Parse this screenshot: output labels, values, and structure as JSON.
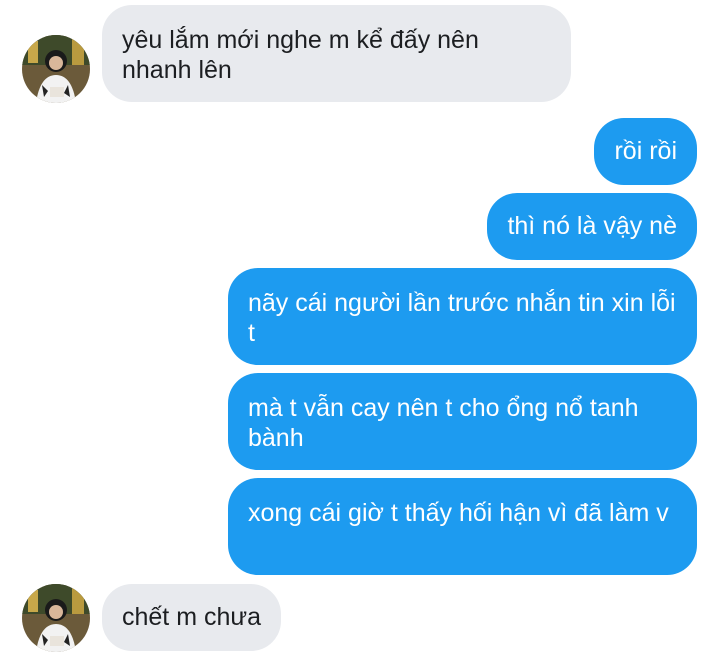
{
  "conversation": {
    "messages": [
      {
        "direction": "incoming",
        "text": "yêu lắm mới nghe m kể đấy nên nhanh lên"
      },
      {
        "direction": "outgoing",
        "text": "rồi rồi"
      },
      {
        "direction": "outgoing",
        "text": "thì nó là vậy nè"
      },
      {
        "direction": "outgoing",
        "text": "nãy cái người lần trước nhắn tin xin lỗi t"
      },
      {
        "direction": "outgoing",
        "text": "mà t vẫn cay nên t cho ổng nổ tanh bành"
      },
      {
        "direction": "outgoing",
        "text": "xong cái giờ t thấy hối hận vì đã làm v"
      },
      {
        "direction": "incoming",
        "text": "chết m chưa"
      }
    ]
  },
  "colors": {
    "incoming_bubble": "#e8eaee",
    "outgoing_bubble": "#1d9bf0",
    "incoming_text": "#1c1e21",
    "outgoing_text": "#ffffff"
  },
  "icons": {
    "contact_avatar": "contact-avatar-photo"
  }
}
